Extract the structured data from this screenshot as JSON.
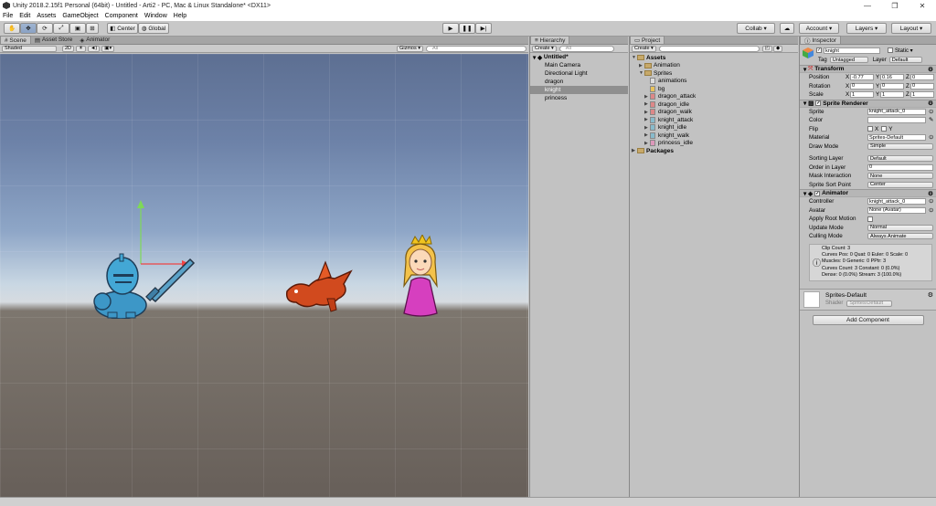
{
  "window": {
    "title": "Unity 2018.2.15f1 Personal (64bit) - Untitled - Arti2 - PC, Mac & Linux Standalone* <DX11>",
    "min": "—",
    "max": "❐",
    "close": "✕"
  },
  "menu": [
    "File",
    "Edit",
    "Assets",
    "GameObject",
    "Component",
    "Window",
    "Help"
  ],
  "toolbar": {
    "pivot": "Center",
    "space": "Global",
    "collab": "Collab ▾",
    "account": "Account ▾",
    "layers": "Layers ▾",
    "layout": "Layout ▾"
  },
  "scene": {
    "tabs": [
      "Scene",
      "Asset Store",
      "Animator"
    ],
    "shading": "Shaded",
    "mode2d": "2D",
    "gizmos": "Gizmos ▾",
    "search_placeholder": "All"
  },
  "hierarchy": {
    "tab": "Hierarchy",
    "create": "Create ▾",
    "search_placeholder": "All",
    "scene_name": "Untitled*",
    "items": [
      "Main Camera",
      "Directional Light",
      "dragon",
      "knight",
      "princess"
    ],
    "selected_index": 3
  },
  "project": {
    "tab": "Project",
    "create": "Create ▾",
    "assets": "Assets",
    "animation": "Animation",
    "sprites": "Sprites",
    "sprite_items": [
      "animations",
      "bg",
      "dragon_attack",
      "dragon_idle",
      "dragon_walk",
      "knight_attack",
      "knight_idle",
      "knight_walk",
      "princess_idle"
    ],
    "packages": "Packages"
  },
  "inspector": {
    "tab": "Inspector",
    "object_name": "knight",
    "static_label": "Static ▾",
    "tag_label": "Tag",
    "tag_value": "Untagged",
    "layer_label": "Layer",
    "layer_value": "Default",
    "transform": {
      "header": "Transform",
      "rows": [
        {
          "label": "Position",
          "x": "-0.77",
          "y": "0.16",
          "z": "0"
        },
        {
          "label": "Rotation",
          "x": "0",
          "y": "0",
          "z": "0"
        },
        {
          "label": "Scale",
          "x": "1",
          "y": "1",
          "z": "1"
        }
      ]
    },
    "sprite_renderer": {
      "header": "Sprite Renderer",
      "sprite_label": "Sprite",
      "sprite_value": "knight_attack_0",
      "color_label": "Color",
      "flip_label": "Flip",
      "flip_x": "X",
      "flip_y": "Y",
      "material_label": "Material",
      "material_value": "Sprites-Default",
      "draw_mode_label": "Draw Mode",
      "draw_mode_value": "Simple",
      "sorting_layer_label": "Sorting Layer",
      "sorting_layer_value": "Default",
      "order_label": "Order in Layer",
      "order_value": "0",
      "mask_label": "Mask Interaction",
      "mask_value": "None",
      "sort_point_label": "Sprite Sort Point",
      "sort_point_value": "Center"
    },
    "animator": {
      "header": "Animator",
      "controller_label": "Controller",
      "controller_value": "knight_attack_0",
      "avatar_label": "Avatar",
      "avatar_value": "None (Avatar)",
      "root_motion_label": "Apply Root Motion",
      "update_label": "Update Mode",
      "update_value": "Normal",
      "culling_label": "Culling Mode",
      "culling_value": "Always Animate",
      "info": [
        "Clip Count: 3",
        "Curves Pos: 0 Quat: 0 Euler: 0 Scale: 0",
        "Muscles: 0 Generic: 0 PPtr: 3",
        "Curves Count: 3 Constant: 0 (0.0%)",
        "Dense: 0 (0.0%) Stream: 3 (100.0%)"
      ]
    },
    "material": {
      "name": "Sprites-Default",
      "shader_label": "Shader",
      "shader_value": "Sprites/Default"
    },
    "add_component": "Add Component"
  }
}
